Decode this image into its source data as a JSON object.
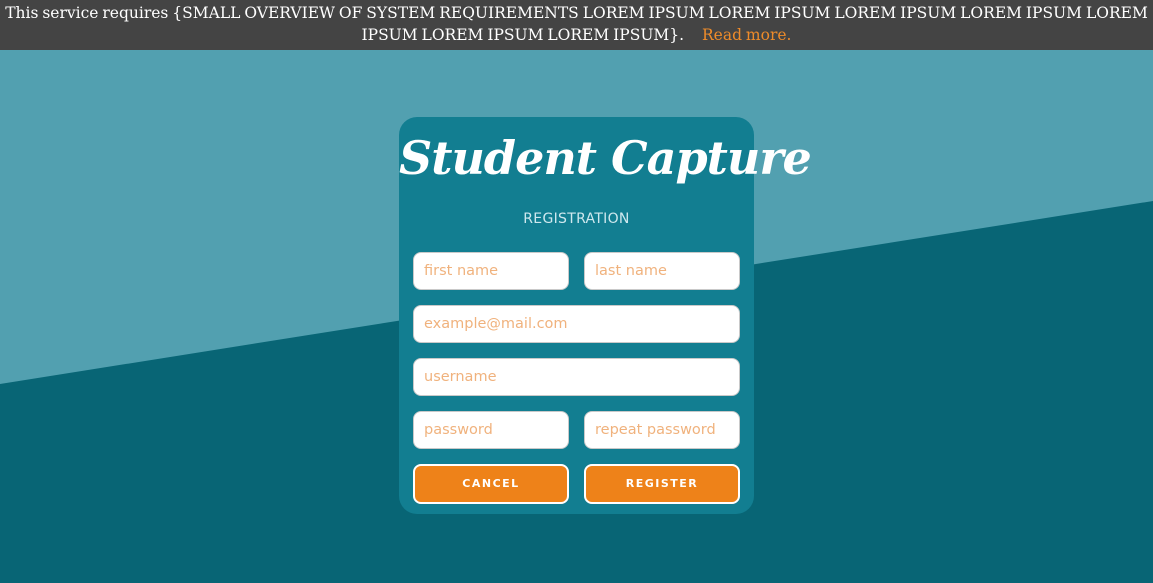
{
  "banner": {
    "text": "This service requires {SMALL OVERVIEW OF SYSTEM REQUIREMENTS LOREM IPSUM LOREM IPSUM LOREM IPSUM LOREM IPSUM LOREM IPSUM LOREM IPSUM LOREM IPSUM}.",
    "link": "Read more."
  },
  "form": {
    "logo": "Student Capture",
    "subtitle": "REGISTRATION",
    "first_name_placeholder": "first name",
    "last_name_placeholder": "last name",
    "email_placeholder": "example@mail.com",
    "username_placeholder": "username",
    "password_placeholder": "password",
    "repeat_password_placeholder": "repeat password",
    "cancel_label": "CANCEL",
    "register_label": "REGISTER"
  },
  "colors": {
    "banner_bg": "#444444",
    "bg_light": "#52a0b0",
    "bg_dark": "#086575",
    "card": "#127e91",
    "accent": "#ee8219",
    "placeholder": "#f0b27d"
  }
}
